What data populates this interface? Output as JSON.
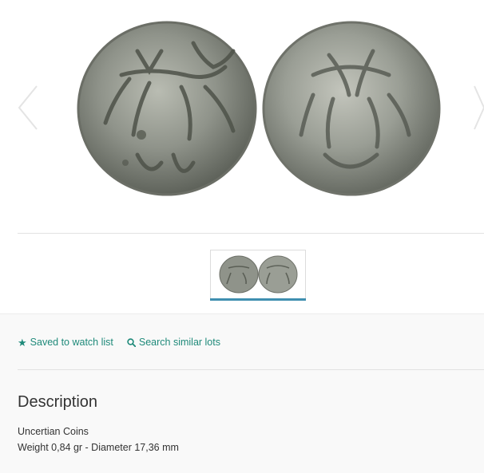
{
  "gallery": {
    "main_image": "coin-obverse-reverse",
    "prev_icon": "chevron-left-icon",
    "next_icon": "chevron-right-icon",
    "thumbnail": "coin-thumbnail"
  },
  "actions": {
    "watch_label": "Saved to watch list",
    "watch_icon": "star-icon",
    "search_label": "Search similar lots",
    "search_icon": "magnifier-icon"
  },
  "description": {
    "title": "Description",
    "line1": "Uncertian Coins",
    "line2": "Weight 0,84 gr - Diameter 17,36 mm"
  },
  "colors": {
    "accent": "#1f8a7a",
    "thumb_underline": "#3f8fb0"
  }
}
